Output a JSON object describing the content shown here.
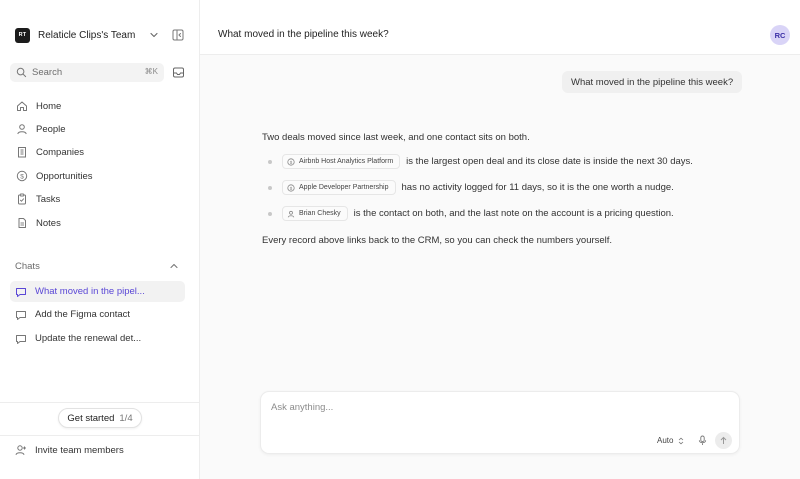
{
  "sidebar": {
    "team": {
      "badge": "RT",
      "name": "Relaticle Clips's Team"
    },
    "search": {
      "placeholder": "Search",
      "shortcut": "⌘K"
    },
    "nav": [
      {
        "label": "Home",
        "icon": "home-icon"
      },
      {
        "label": "People",
        "icon": "person-icon"
      },
      {
        "label": "Companies",
        "icon": "building-icon"
      },
      {
        "label": "Opportunities",
        "icon": "dollar-icon"
      },
      {
        "label": "Tasks",
        "icon": "tasks-icon"
      },
      {
        "label": "Notes",
        "icon": "note-icon"
      }
    ],
    "chats_heading": "Chats",
    "chats": [
      {
        "label": "What moved in the pipel...",
        "active": true
      },
      {
        "label": "Add the Figma contact",
        "active": false
      },
      {
        "label": "Update the renewal det...",
        "active": false
      }
    ],
    "get_started": {
      "label": "Get started",
      "progress": "1/4"
    },
    "invite": "Invite team members"
  },
  "header": {
    "title": "What moved in the pipeline this week?",
    "avatar": "RC"
  },
  "conversation": {
    "user_message": "What moved in the pipeline this week?",
    "intro": "Two deals moved since last week, and one contact sits on both.",
    "bullets": [
      {
        "chip": "Airbnb Host Analytics Platform",
        "chip_icon": "deal-icon",
        "text": "is the largest open deal and its close date is inside the next 30 days."
      },
      {
        "chip": "Apple Developer Partnership",
        "chip_icon": "deal-icon",
        "text": "has no activity logged for 11 days, so it is the one worth a nudge."
      },
      {
        "chip": "Brian Chesky",
        "chip_icon": "person-icon",
        "text": "is the contact on both, and the last note on the account is a pricing question."
      }
    ],
    "outro": "Every record above links back to the CRM, so you can check the numbers yourself."
  },
  "composer": {
    "placeholder": "Ask anything...",
    "mode": "Auto"
  },
  "colors": {
    "accent": "#5a47d6",
    "avatar_bg": "#d9d4f7",
    "sidebar_bg": "#ffffff",
    "main_bg": "#fafafa"
  }
}
